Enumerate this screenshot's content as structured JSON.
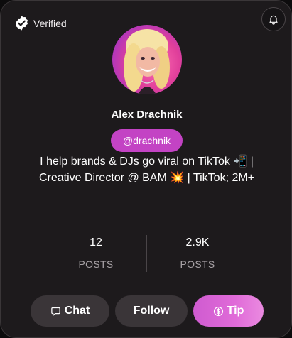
{
  "badge": {
    "label": "Verified",
    "icon": "verified-check-icon"
  },
  "bell": {
    "icon": "bell-icon"
  },
  "profile": {
    "avatar_icon": "profile-photo",
    "name": "Alex Drachnik",
    "handle": "@drachnik",
    "bio_line1": "I help brands & DJs go viral on TikTok 📲 |",
    "bio_line2": "Creative Director @ BAM 💥 | TikTok; 2M+"
  },
  "stats": {
    "posts": {
      "value": "12",
      "label": "POSTS"
    },
    "second": {
      "value": "2.9K",
      "label": "POSTS"
    }
  },
  "actions": {
    "chat_label": "Chat",
    "chat_icon": "chat-bubble-icon",
    "follow_label": "Follow",
    "tip_label": "Tip",
    "tip_icon": "dollar-coin-icon"
  },
  "colors": {
    "card_background": "#1d1a1c",
    "handle_pill": "#c343c4",
    "tip_gradient_start": "#cf5bd0",
    "tip_gradient_end": "#ea8ae0",
    "button_background": "#3a3538"
  }
}
